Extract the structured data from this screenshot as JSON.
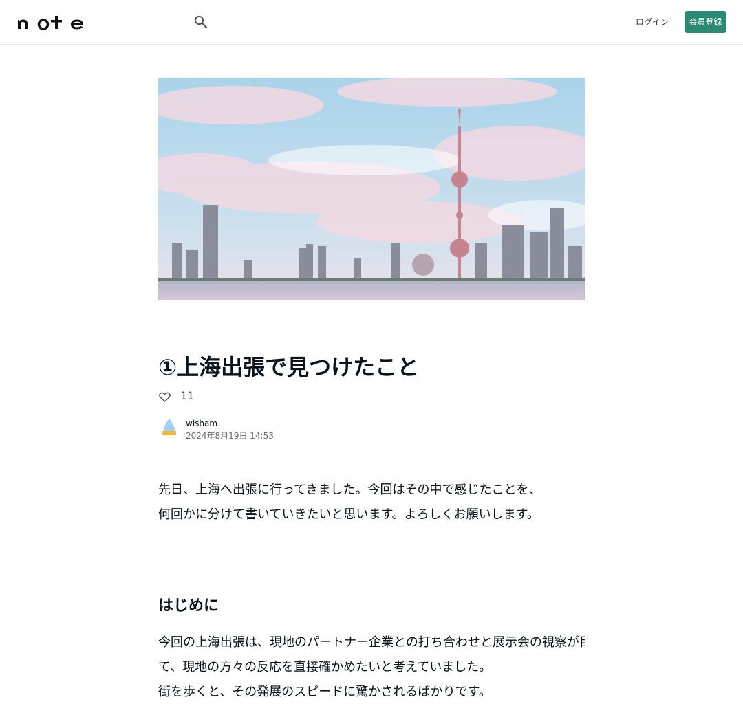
{
  "header": {
    "logo_text": "note",
    "login_label": "ログイン",
    "signup_label": "会員登録"
  },
  "article": {
    "title": "①上海出張で見つけたこと",
    "likes": "11",
    "author": "wisham",
    "date": "2024年8月19日 14:53",
    "intro": [
      "先日、上海へ出張に行ってきました。今回はその中で感じたことを、",
      "何回かに分けて書いていきたいと思います。よろしくお願いします。"
    ],
    "section_heading": "はじめに",
    "section_body": [
      "今回の上海出張は、現地のパートナー企業との打ち合わせと展示会の視察が目的でした。弊社が扱うGelletta®につい",
      "て、現地の方々の反応を直接確かめたいと考えていました。",
      "街を歩くと、その発展のスピードに驚かされるばかりです。"
    ]
  },
  "colors": {
    "accent": "#2a8a74",
    "text": "#08131a",
    "muted": "#6b6b6b"
  },
  "icons": [
    "search-icon",
    "heart-icon"
  ]
}
